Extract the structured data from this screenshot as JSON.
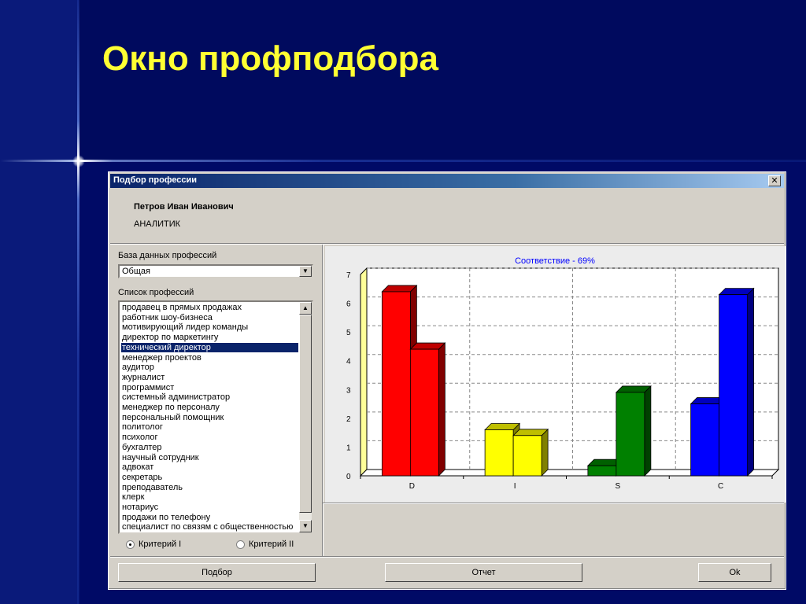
{
  "slide": {
    "title": "Окно профподбора"
  },
  "window": {
    "title": "Подбор профессии",
    "close_glyph": "✕",
    "user": {
      "name": "Петров Иван Иванович",
      "role": "АНАЛИТИК"
    },
    "database": {
      "label": "База данных профессий",
      "selected": "Общая"
    },
    "professions": {
      "label": "Список профессий",
      "selected_index": 4,
      "items": [
        "продавец в прямых продажах",
        "работник шоу-бизнеса",
        "мотивирующий лидер команды",
        "директор по маркетингу",
        "технический директор",
        "менеджер проектов",
        "аудитор",
        "журналист",
        "программист",
        "системный администратор",
        "менеджер по персоналу",
        "персональный помощник",
        "политолог",
        "психолог",
        "бухгалтер",
        "научный сотрудник",
        "адвокат",
        "секретарь",
        "преподаватель",
        "клерк",
        "нотариус",
        "продажи по телефону",
        "специалист по связям с общественностью"
      ]
    },
    "criteria": [
      {
        "label": "Критерий I",
        "checked": true
      },
      {
        "label": "Критерий II",
        "checked": false
      }
    ],
    "buttons": {
      "select": "Подбор",
      "report": "Отчет",
      "ok": "Ok"
    }
  },
  "chart_data": {
    "type": "bar",
    "title": "Соответствие - 69%",
    "categories": [
      "D",
      "I",
      "S",
      "C"
    ],
    "series": [
      {
        "values": [
          6.4,
          1.6,
          0.35,
          2.5
        ]
      },
      {
        "values": [
          4.4,
          1.4,
          2.9,
          6.3
        ]
      }
    ],
    "colors": [
      "#ff0000",
      "#ffff00",
      "#008000",
      "#0000ff"
    ],
    "ylim": [
      0,
      7
    ],
    "yticks": [
      0,
      1,
      2,
      3,
      4,
      5,
      6,
      7
    ],
    "grid": true,
    "xlabel": "",
    "ylabel": ""
  }
}
